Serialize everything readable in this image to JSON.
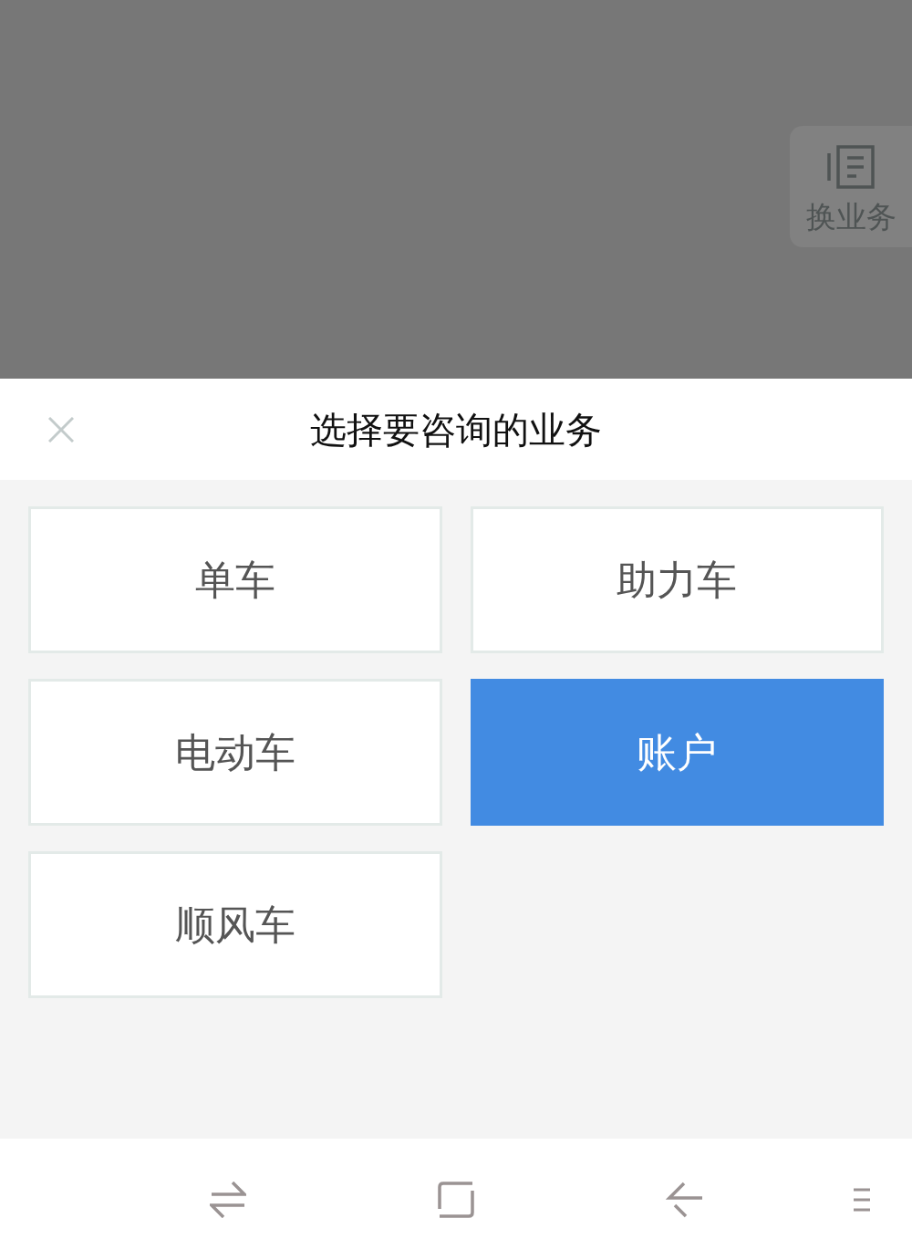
{
  "overlay": {
    "switch_button": {
      "label": "换业务"
    }
  },
  "sheet": {
    "title": "选择要咨询的业务",
    "options": [
      {
        "label": "单车",
        "selected": false
      },
      {
        "label": "助力车",
        "selected": false
      },
      {
        "label": "电动车",
        "selected": false
      },
      {
        "label": "账户",
        "selected": true
      },
      {
        "label": "顺风车",
        "selected": false
      }
    ]
  }
}
